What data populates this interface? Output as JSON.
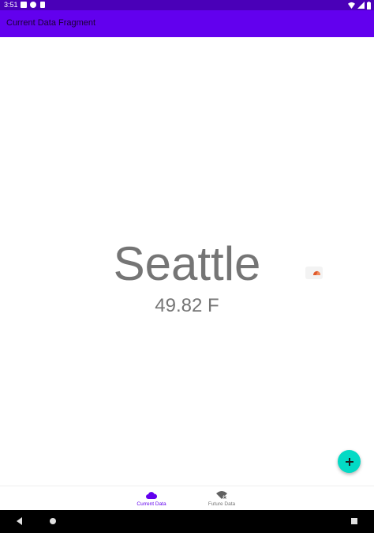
{
  "status_bar": {
    "time": "3:51",
    "background": "#4a00b8",
    "notification_icons": [
      "android-notification-icon",
      "settings-notification-icon",
      "sd-card-icon"
    ],
    "system_icons": [
      "wifi-icon",
      "cellular-signal-icon",
      "battery-icon"
    ]
  },
  "app_bar": {
    "title": "Current Data Fragment",
    "background": "#6200ee"
  },
  "main": {
    "city": "Seattle",
    "temperature": "49.82 F",
    "weather_icon": "weather-condition-icon",
    "text_color": "#757575"
  },
  "fab": {
    "icon": "plus-icon",
    "color": "#03dac5"
  },
  "bottom_nav": {
    "items": [
      {
        "label": "Current Data",
        "icon": "cloud-icon",
        "selected": true
      },
      {
        "label": "Future Data",
        "icon": "wifi-off-icon",
        "selected": false
      }
    ],
    "selected_color": "#6200ee",
    "unselected_color": "#757575"
  },
  "system_nav": {
    "buttons": [
      "back-icon",
      "home-icon",
      "recents-icon"
    ]
  }
}
